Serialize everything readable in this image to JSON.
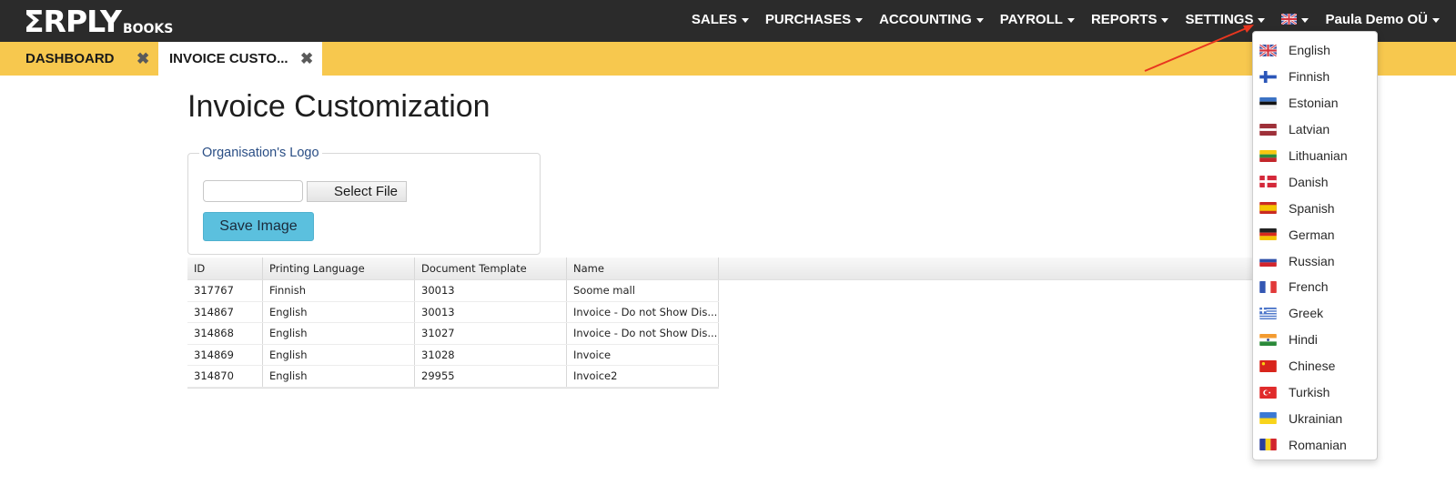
{
  "app": {
    "logo_main": "ΣRPLY",
    "logo_sub": "BOOKS"
  },
  "nav": {
    "items": [
      {
        "label": "SALES"
      },
      {
        "label": "PURCHASES"
      },
      {
        "label": "ACCOUNTING"
      },
      {
        "label": "PAYROLL"
      },
      {
        "label": "REPORTS"
      },
      {
        "label": "SETTINGS"
      }
    ],
    "language_flag": "uk-flag",
    "user": "Paula Demo OÜ"
  },
  "tabs": [
    {
      "label": "DASHBOARD",
      "close": "✖"
    },
    {
      "label": "INVOICE CUSTO...",
      "close": "✖"
    }
  ],
  "page": {
    "title": "Invoice Customization"
  },
  "logo_section": {
    "legend": "Organisation's Logo",
    "file_value": "",
    "select_file_label": "Select File",
    "save_image_label": "Save Image"
  },
  "table": {
    "columns": [
      "ID",
      "Printing Language",
      "Document Template",
      "Name"
    ],
    "rows": [
      [
        "317767",
        "Finnish",
        "30013",
        "Soome mall"
      ],
      [
        "314867",
        "English",
        "30013",
        "Invoice - Do not Show Dis..."
      ],
      [
        "314868",
        "English",
        "31027",
        "Invoice - Do not Show Dis..."
      ],
      [
        "314869",
        "English",
        "31028",
        "Invoice"
      ],
      [
        "314870",
        "English",
        "29955",
        "Invoice2"
      ]
    ]
  },
  "language_menu": {
    "items": [
      {
        "label": "English",
        "flag": "uk"
      },
      {
        "label": "Finnish",
        "flag": "fi"
      },
      {
        "label": "Estonian",
        "flag": "ee"
      },
      {
        "label": "Latvian",
        "flag": "lv"
      },
      {
        "label": "Lithuanian",
        "flag": "lt"
      },
      {
        "label": "Danish",
        "flag": "dk"
      },
      {
        "label": "Spanish",
        "flag": "es"
      },
      {
        "label": "German",
        "flag": "de"
      },
      {
        "label": "Russian",
        "flag": "ru"
      },
      {
        "label": "French",
        "flag": "fr"
      },
      {
        "label": "Greek",
        "flag": "gr"
      },
      {
        "label": "Hindi",
        "flag": "in"
      },
      {
        "label": "Chinese",
        "flag": "cn"
      },
      {
        "label": "Turkish",
        "flag": "tr"
      },
      {
        "label": "Ukrainian",
        "flag": "ua"
      },
      {
        "label": "Romanian",
        "flag": "ro"
      }
    ]
  },
  "colors": {
    "topbar": "#2b2b2b",
    "tabbar": "#f7c84e",
    "save_button": "#5bc0de",
    "legend_text": "#2a4e85",
    "annotation_arrow": "#e8361f"
  }
}
